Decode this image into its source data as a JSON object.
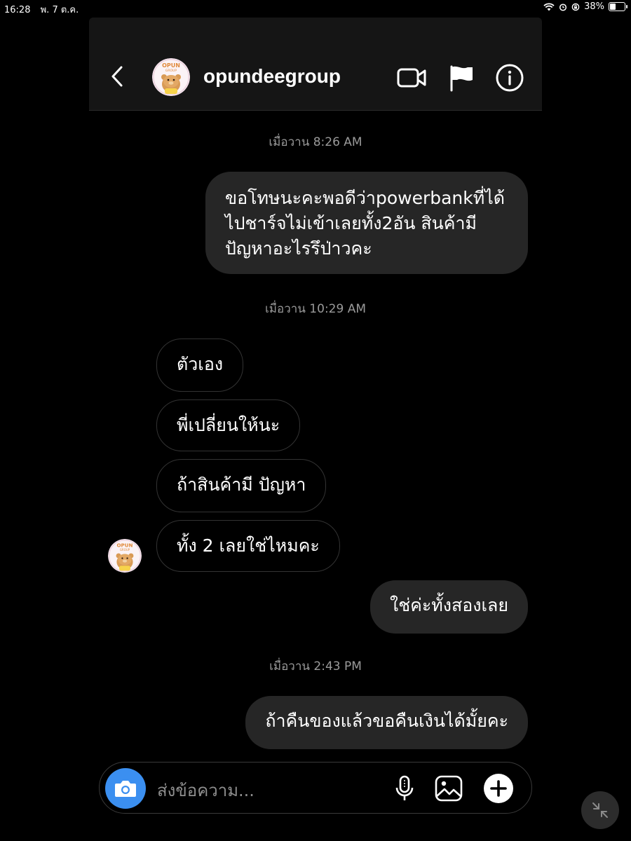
{
  "status_bar": {
    "time": "16:28",
    "date": "พ. 7 ต.ค.",
    "battery": "38%",
    "battery_level": 0.38
  },
  "header": {
    "username": "opundeegroup",
    "avatar_text_top": "OPUN",
    "avatar_text_bottom": "GROUP",
    "icons": [
      "back-icon",
      "video-call-icon",
      "flag-icon",
      "info-icon"
    ]
  },
  "messages": [
    {
      "type": "timestamp",
      "text": "เมื่อวาน 8:26 AM"
    },
    {
      "type": "outgoing",
      "lines": [
        "ขอโทษนะคะพอดีว่าpowerbankที่ได้",
        "ไปชาร์จไม่เข้าเลยทั้ง2อัน สินค้ามี",
        "ปัญหาอะไรรึป่าวคะ"
      ]
    },
    {
      "type": "timestamp",
      "text": "เมื่อวาน 10:29 AM"
    },
    {
      "type": "incoming",
      "text": "ตัวเอง"
    },
    {
      "type": "incoming",
      "text": "พี่เปลี่ยนให้นะ"
    },
    {
      "type": "incoming",
      "text": "ถ้าสินค้ามี ปัญหา"
    },
    {
      "type": "incoming",
      "text": "ทั้ง 2 เลยใช่ไหมคะ"
    },
    {
      "type": "outgoing",
      "text": "ใช่ค่ะทั้งสองเลย"
    },
    {
      "type": "timestamp",
      "text": "เมื่อวาน 2:43 PM"
    },
    {
      "type": "outgoing",
      "text": "ถ้าคืนของแล้วขอคืนเงินได้มั้ยคะ"
    }
  ],
  "composer": {
    "placeholder": "ส่งข้อความ...",
    "icons": [
      "camera-icon",
      "microphone-icon",
      "gallery-icon",
      "add-icon"
    ]
  },
  "colors": {
    "background": "#000000",
    "header": "#151515",
    "outgoing_bubble": "#262626",
    "incoming_border": "#333333",
    "timestamp": "#9a9a9a",
    "camera_button": "#3b8ff0"
  }
}
